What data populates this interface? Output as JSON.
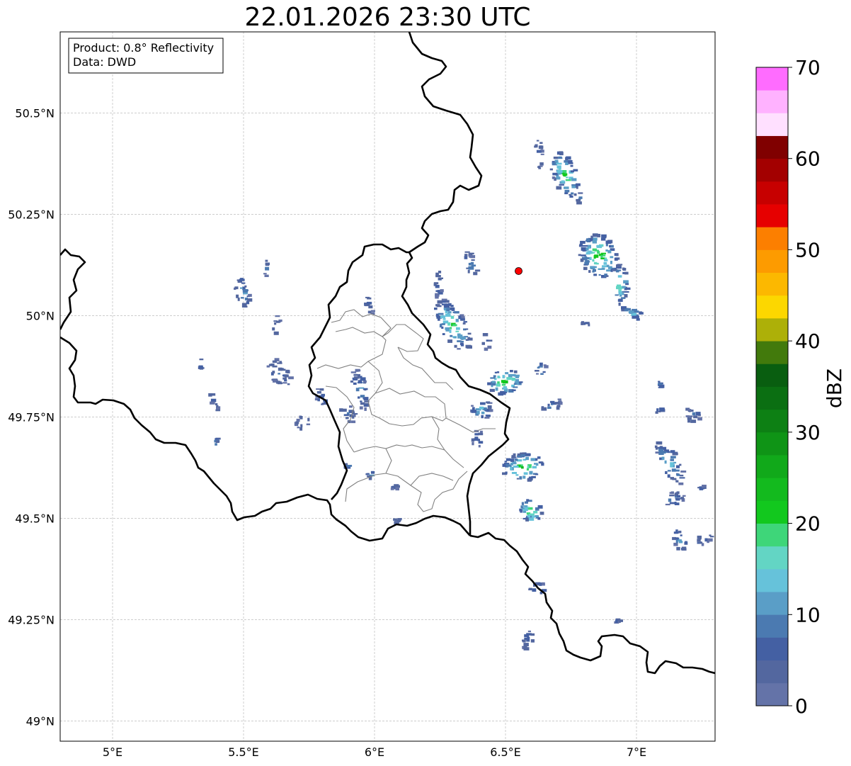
{
  "title": "22.01.2026 23:30 UTC",
  "info_box": {
    "product": "Product: 0.8° Reflectivity",
    "data": "Data: DWD"
  },
  "map": {
    "extent": {
      "lon_min": 4.8,
      "lon_max": 7.3,
      "lat_min": 48.95,
      "lat_max": 50.7
    },
    "grid": true,
    "x_ticks": [
      {
        "value": 5.0,
        "label": "5°E"
      },
      {
        "value": 5.5,
        "label": "5.5°E"
      },
      {
        "value": 6.0,
        "label": "6°E"
      },
      {
        "value": 6.5,
        "label": "6.5°E"
      },
      {
        "value": 7.0,
        "label": "7°E"
      }
    ],
    "y_ticks": [
      {
        "value": 50.5,
        "label": "50.5°N"
      },
      {
        "value": 50.25,
        "label": "50.25°N"
      },
      {
        "value": 50.0,
        "label": "50°N"
      },
      {
        "value": 49.75,
        "label": "49.75°N"
      },
      {
        "value": 49.5,
        "label": "49.5°N"
      },
      {
        "value": 49.25,
        "label": "49.25°N"
      },
      {
        "value": 49.0,
        "label": "49°N"
      }
    ],
    "radar_site": {
      "lon": 6.55,
      "lat": 50.11,
      "color": "#ff0000"
    },
    "borders_color": "#000000",
    "subregion_color": "#808080"
  },
  "colorbar": {
    "label": "dBZ",
    "min": 0,
    "max": 70,
    "step": 2.5,
    "tick_labels": [
      "0",
      "10",
      "20",
      "30",
      "40",
      "50",
      "60",
      "70"
    ],
    "colors": [
      "#6473a8",
      "#53679f",
      "#4460a3",
      "#4b7ab1",
      "#5a9ec7",
      "#66c2da",
      "#63d5c4",
      "#3ed679",
      "#12c81e",
      "#13ba1e",
      "#11a91a",
      "#0f9416",
      "#0d8014",
      "#0b6f12",
      "#095e10",
      "#427a0c",
      "#adb008",
      "#fcd700",
      "#fcb800",
      "#fd9b00",
      "#fc7f00",
      "#e60000",
      "#c70000",
      "#a30000",
      "#800000",
      "#ffe0ff",
      "#ffb2ff",
      "#ff6cff",
      "#ee34ee"
    ]
  },
  "echoes": [
    {
      "lon": 6.72,
      "lat": 50.35,
      "rx": 0.045,
      "ry": 0.06,
      "ang": -20,
      "peak": 22
    },
    {
      "lon": 6.62,
      "lat": 50.4,
      "rx": 0.015,
      "ry": 0.04,
      "ang": 0,
      "peak": 8
    },
    {
      "lon": 6.78,
      "lat": 50.29,
      "rx": 0.015,
      "ry": 0.015,
      "ang": 0,
      "peak": 10
    },
    {
      "lon": 6.85,
      "lat": 50.15,
      "rx": 0.07,
      "ry": 0.06,
      "ang": -30,
      "peak": 24
    },
    {
      "lon": 6.93,
      "lat": 50.08,
      "rx": 0.03,
      "ry": 0.05,
      "ang": 0,
      "peak": 20
    },
    {
      "lon": 6.98,
      "lat": 50.01,
      "rx": 0.05,
      "ry": 0.015,
      "ang": 20,
      "peak": 15
    },
    {
      "lon": 6.29,
      "lat": 49.98,
      "rx": 0.05,
      "ry": 0.07,
      "ang": -30,
      "peak": 21
    },
    {
      "lon": 6.24,
      "lat": 50.08,
      "rx": 0.015,
      "ry": 0.04,
      "ang": 0,
      "peak": 8
    },
    {
      "lon": 6.36,
      "lat": 50.13,
      "rx": 0.02,
      "ry": 0.035,
      "ang": -20,
      "peak": 10
    },
    {
      "lon": 6.49,
      "lat": 49.84,
      "rx": 0.07,
      "ry": 0.03,
      "ang": -15,
      "peak": 24
    },
    {
      "lon": 6.4,
      "lat": 49.77,
      "rx": 0.04,
      "ry": 0.025,
      "ang": -30,
      "peak": 15
    },
    {
      "lon": 6.63,
      "lat": 49.87,
      "rx": 0.02,
      "ry": 0.02,
      "ang": 0,
      "peak": 14
    },
    {
      "lon": 6.56,
      "lat": 49.63,
      "rx": 0.08,
      "ry": 0.035,
      "ang": -10,
      "peak": 24
    },
    {
      "lon": 6.59,
      "lat": 49.52,
      "rx": 0.04,
      "ry": 0.035,
      "ang": -30,
      "peak": 22
    },
    {
      "lon": 6.67,
      "lat": 49.78,
      "rx": 0.04,
      "ry": 0.015,
      "ang": -25,
      "peak": 10
    },
    {
      "lon": 6.39,
      "lat": 49.7,
      "rx": 0.025,
      "ry": 0.02,
      "ang": 0,
      "peak": 10
    },
    {
      "lon": 7.12,
      "lat": 49.64,
      "rx": 0.035,
      "ry": 0.06,
      "ang": -30,
      "peak": 16
    },
    {
      "lon": 7.14,
      "lat": 49.55,
      "rx": 0.04,
      "ry": 0.02,
      "ang": -30,
      "peak": 10
    },
    {
      "lon": 7.16,
      "lat": 49.45,
      "rx": 0.025,
      "ry": 0.03,
      "ang": -20,
      "peak": 12
    },
    {
      "lon": 7.25,
      "lat": 49.45,
      "rx": 0.035,
      "ry": 0.015,
      "ang": -30,
      "peak": 9
    },
    {
      "lon": 7.21,
      "lat": 49.76,
      "rx": 0.03,
      "ry": 0.02,
      "ang": 30,
      "peak": 9
    },
    {
      "lon": 6.62,
      "lat": 49.33,
      "rx": 0.035,
      "ry": 0.015,
      "ang": 0,
      "peak": 13
    },
    {
      "lon": 6.58,
      "lat": 49.2,
      "rx": 0.025,
      "ry": 0.025,
      "ang": 0,
      "peak": 8
    },
    {
      "lon": 5.49,
      "lat": 50.06,
      "rx": 0.025,
      "ry": 0.04,
      "ang": -15,
      "peak": 14
    },
    {
      "lon": 5.63,
      "lat": 49.86,
      "rx": 0.035,
      "ry": 0.04,
      "ang": -30,
      "peak": 9
    },
    {
      "lon": 5.62,
      "lat": 49.98,
      "rx": 0.015,
      "ry": 0.025,
      "ang": 0,
      "peak": 8
    },
    {
      "lon": 5.94,
      "lat": 49.82,
      "rx": 0.03,
      "ry": 0.05,
      "ang": -15,
      "peak": 11
    },
    {
      "lon": 5.89,
      "lat": 49.76,
      "rx": 0.03,
      "ry": 0.025,
      "ang": -30,
      "peak": 9
    },
    {
      "lon": 5.79,
      "lat": 49.8,
      "rx": 0.02,
      "ry": 0.03,
      "ang": -20,
      "peak": 9
    },
    {
      "lon": 5.72,
      "lat": 49.74,
      "rx": 0.03,
      "ry": 0.015,
      "ang": -30,
      "peak": 8
    },
    {
      "lon": 5.38,
      "lat": 49.79,
      "rx": 0.012,
      "ry": 0.03,
      "ang": -20,
      "peak": 8
    },
    {
      "lon": 5.97,
      "lat": 50.03,
      "rx": 0.015,
      "ry": 0.025,
      "ang": -20,
      "peak": 8
    },
    {
      "lon": 5.58,
      "lat": 50.12,
      "rx": 0.008,
      "ry": 0.02,
      "ang": 0,
      "peak": 7
    },
    {
      "lon": 5.89,
      "lat": 49.63,
      "rx": 0.01,
      "ry": 0.015,
      "ang": 0,
      "peak": 14
    },
    {
      "lon": 5.98,
      "lat": 49.61,
      "rx": 0.015,
      "ry": 0.01,
      "ang": -30,
      "peak": 16
    },
    {
      "lon": 6.07,
      "lat": 49.58,
      "rx": 0.015,
      "ry": 0.006,
      "ang": -20,
      "peak": 8
    },
    {
      "lon": 6.08,
      "lat": 49.5,
      "rx": 0.015,
      "ry": 0.008,
      "ang": -20,
      "peak": 8
    },
    {
      "lon": 6.42,
      "lat": 49.94,
      "rx": 0.015,
      "ry": 0.02,
      "ang": 0,
      "peak": 10
    },
    {
      "lon": 6.8,
      "lat": 49.98,
      "rx": 0.02,
      "ry": 0.01,
      "ang": 0,
      "peak": 8
    },
    {
      "lon": 7.08,
      "lat": 49.83,
      "rx": 0.012,
      "ry": 0.02,
      "ang": 0,
      "peak": 9
    },
    {
      "lon": 7.08,
      "lat": 49.77,
      "rx": 0.015,
      "ry": 0.01,
      "ang": 0,
      "peak": 9
    },
    {
      "lon": 5.39,
      "lat": 49.69,
      "rx": 0.005,
      "ry": 0.012,
      "ang": 0,
      "peak": 15
    },
    {
      "lon": 5.33,
      "lat": 49.88,
      "rx": 0.005,
      "ry": 0.015,
      "ang": 0,
      "peak": 8
    },
    {
      "lon": 6.92,
      "lat": 49.25,
      "rx": 0.012,
      "ry": 0.005,
      "ang": 0,
      "peak": 8
    },
    {
      "lon": 7.24,
      "lat": 49.58,
      "rx": 0.01,
      "ry": 0.012,
      "ang": 0,
      "peak": 8
    }
  ]
}
